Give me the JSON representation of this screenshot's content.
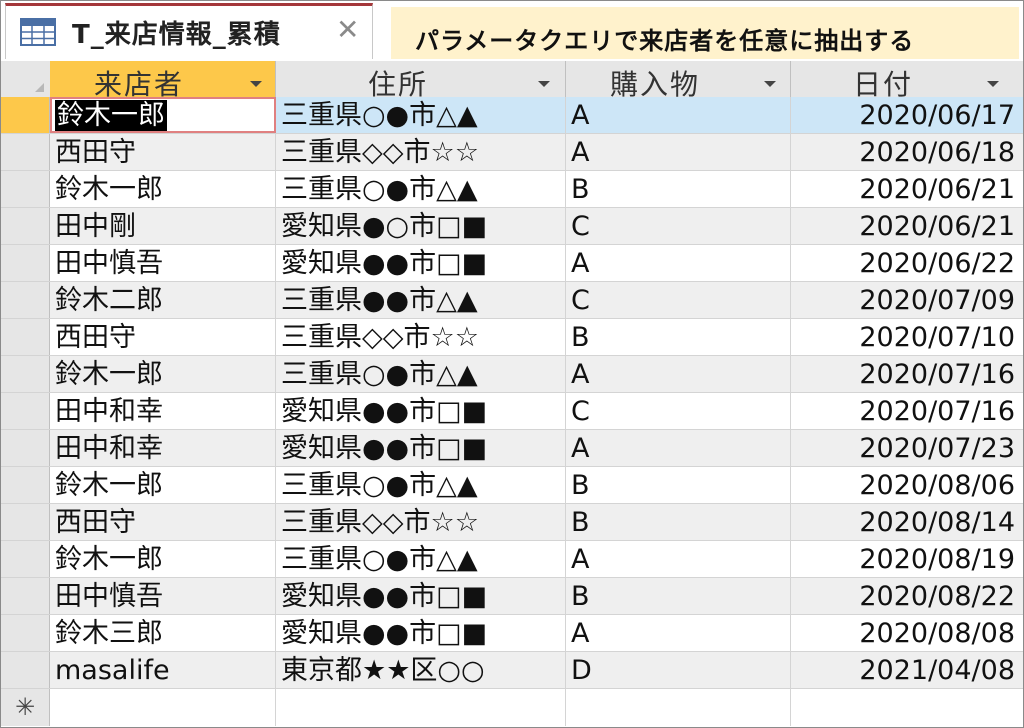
{
  "tab": {
    "title": "T_来店情報_累積",
    "close_glyph": "✕",
    "icon": "table-icon"
  },
  "callout": {
    "text": "パラメータクエリで来店者を任意に抽出する",
    "color": "#fff2cc"
  },
  "columns": [
    {
      "label": "来店者"
    },
    {
      "label": "住所"
    },
    {
      "label": "購入物"
    },
    {
      "label": "日付"
    }
  ],
  "rows": [
    {
      "visitor": "鈴木一郎",
      "address": "三重県○●市△▲",
      "item": "A",
      "date": "2020/06/17"
    },
    {
      "visitor": "西田守",
      "address": "三重県◇◇市☆☆",
      "item": "A",
      "date": "2020/06/18"
    },
    {
      "visitor": "鈴木一郎",
      "address": "三重県○●市△▲",
      "item": "B",
      "date": "2020/06/21"
    },
    {
      "visitor": "田中剛",
      "address": "愛知県●○市□■",
      "item": "C",
      "date": "2020/06/21"
    },
    {
      "visitor": "田中慎吾",
      "address": "愛知県●●市□■",
      "item": "A",
      "date": "2020/06/22"
    },
    {
      "visitor": "鈴木二郎",
      "address": "三重県●●市△▲",
      "item": "C",
      "date": "2020/07/09"
    },
    {
      "visitor": "西田守",
      "address": "三重県◇◇市☆☆",
      "item": "B",
      "date": "2020/07/10"
    },
    {
      "visitor": "鈴木一郎",
      "address": "三重県○●市△▲",
      "item": "A",
      "date": "2020/07/16"
    },
    {
      "visitor": "田中和幸",
      "address": "愛知県●●市□■",
      "item": "C",
      "date": "2020/07/16"
    },
    {
      "visitor": "田中和幸",
      "address": "愛知県●●市□■",
      "item": "A",
      "date": "2020/07/23"
    },
    {
      "visitor": "鈴木一郎",
      "address": "三重県○●市△▲",
      "item": "B",
      "date": "2020/08/06"
    },
    {
      "visitor": "西田守",
      "address": "三重県◇◇市☆☆",
      "item": "B",
      "date": "2020/08/14"
    },
    {
      "visitor": "鈴木一郎",
      "address": "三重県○●市△▲",
      "item": "A",
      "date": "2020/08/19"
    },
    {
      "visitor": "田中慎吾",
      "address": "愛知県●●市□■",
      "item": "B",
      "date": "2020/08/22"
    },
    {
      "visitor": "鈴木三郎",
      "address": "愛知県●●市□■",
      "item": "A",
      "date": "2020/08/08"
    },
    {
      "visitor": "masalife",
      "address": "東京都★★区○○",
      "item": "D",
      "date": "2021/04/08"
    }
  ],
  "new_record_marker": "✳",
  "colors": {
    "tab_accent": "#a4373a",
    "active_header": "#fdc84a",
    "selected_row": "#cde6f7",
    "alt_row": "#efefef"
  }
}
